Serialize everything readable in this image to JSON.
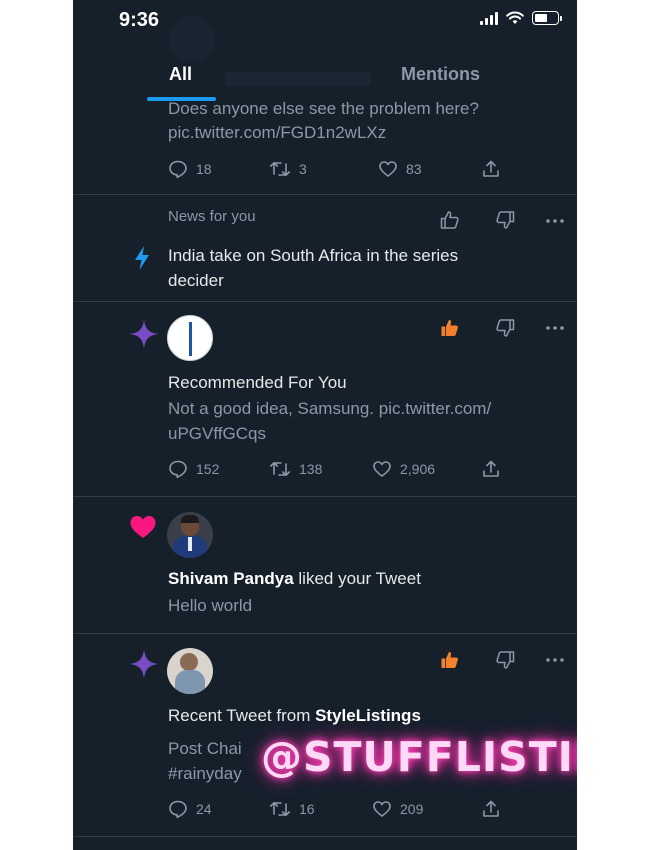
{
  "status_bar": {
    "time": "9:36"
  },
  "tabs": [
    {
      "label": "All"
    },
    {
      "label": "Mentions"
    }
  ],
  "items": [
    {
      "text_line1": "Does anyone else see the problem here?",
      "text_line2": "pic.twitter.com/FGD1n2wLXz",
      "replies": "18",
      "retweets": "3",
      "likes": "83"
    },
    {
      "header": "News for you",
      "headline_line1": "India take on South Africa in the series",
      "headline_line2": "decider"
    },
    {
      "title": "Recommended For You",
      "text_line1": "Not a good idea, Samsung. pic.twitter.com/",
      "text_line2": "uPGVffGCqs",
      "replies": "152",
      "retweets": "138",
      "likes": "2,906"
    },
    {
      "name": "Shivam Pandya",
      "action": " liked your Tweet",
      "text": "Hello world"
    },
    {
      "title_prefix": "Recent Tweet from ",
      "account": "StyleListings",
      "text_line1": "Post Chai",
      "text_line2": "#rainyday",
      "replies": "24",
      "retweets": "16",
      "likes": "209"
    }
  ],
  "watermark": "@STUFFLISTINGS",
  "colors": {
    "background": "#15202b",
    "accent_blue": "#1d9bf0",
    "sparkle_purple": "#794bc4",
    "heart_pink": "#f91880",
    "thumb_orange": "#f4812a",
    "muted_text": "#8b98a5"
  }
}
